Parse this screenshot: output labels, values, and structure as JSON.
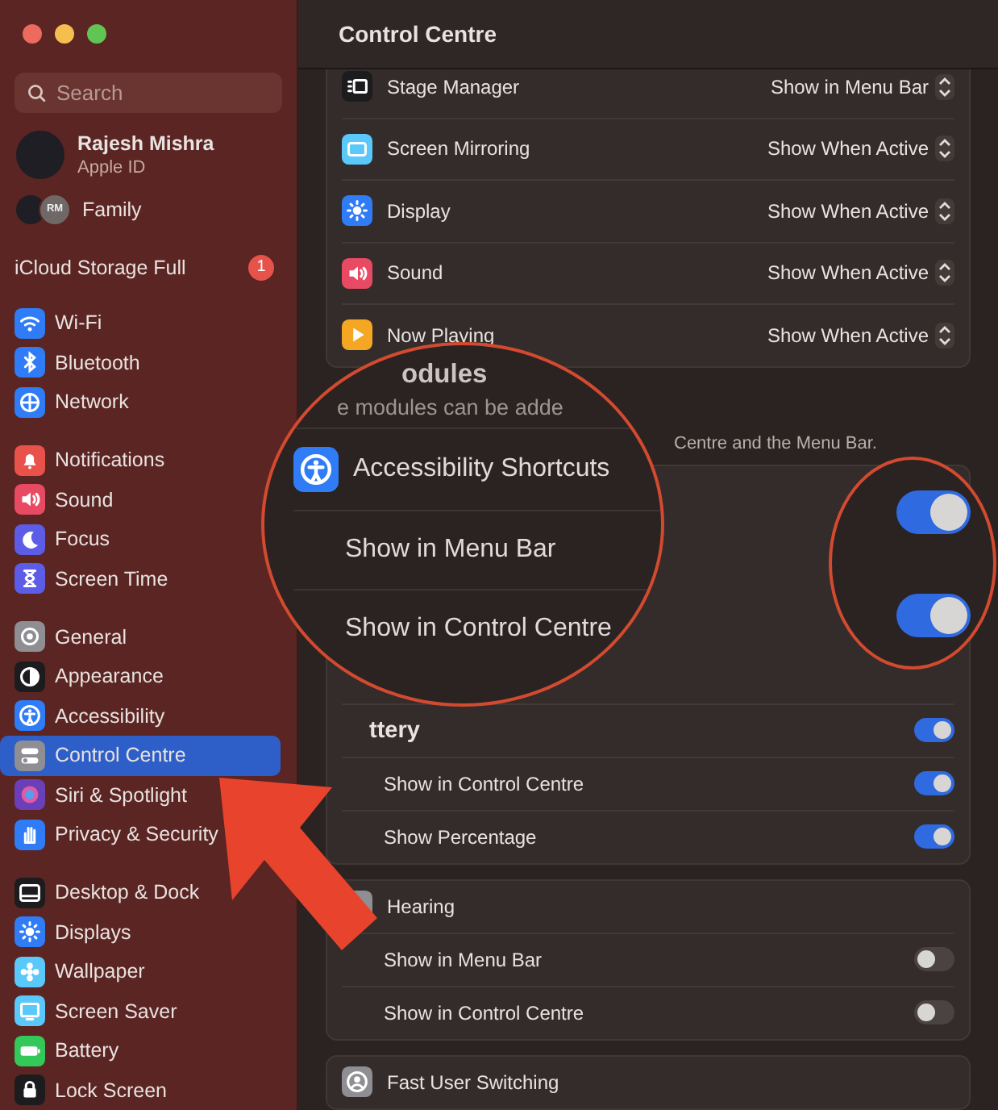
{
  "window": {
    "title": "Control Centre"
  },
  "sidebar": {
    "search": {
      "placeholder": "Search"
    },
    "account": {
      "name": "Rajesh Mishra",
      "subtitle": "Apple ID"
    },
    "family": {
      "initials": "RM",
      "label": "Family"
    },
    "alert": {
      "label": "iCloud Storage Full",
      "badge": "1"
    },
    "groups": [
      [
        {
          "label": "Wi-Fi",
          "selected": false
        },
        {
          "label": "Bluetooth",
          "selected": false
        },
        {
          "label": "Network",
          "selected": false
        }
      ],
      [
        {
          "label": "Notifications",
          "selected": false
        },
        {
          "label": "Sound",
          "selected": false
        },
        {
          "label": "Focus",
          "selected": false
        },
        {
          "label": "Screen Time",
          "selected": false
        }
      ],
      [
        {
          "label": "General",
          "selected": false
        },
        {
          "label": "Appearance",
          "selected": false
        },
        {
          "label": "Accessibility",
          "selected": false
        },
        {
          "label": "Control Centre",
          "selected": true
        },
        {
          "label": "Siri & Spotlight",
          "selected": false
        },
        {
          "label": "Privacy & Security",
          "selected": false
        }
      ],
      [
        {
          "label": "Desktop & Dock",
          "selected": false
        },
        {
          "label": "Displays",
          "selected": false
        },
        {
          "label": "Wallpaper",
          "selected": false
        },
        {
          "label": "Screen Saver",
          "selected": false
        },
        {
          "label": "Battery",
          "selected": false
        },
        {
          "label": "Lock Screen",
          "selected": false
        }
      ]
    ]
  },
  "modules": [
    {
      "label": "Stage Manager",
      "value": "Show in Menu Bar"
    },
    {
      "label": "Screen Mirroring",
      "value": "Show When Active"
    },
    {
      "label": "Display",
      "value": "Show When Active"
    },
    {
      "label": "Sound",
      "value": "Show When Active"
    },
    {
      "label": "Now Playing",
      "value": "Show When Active"
    }
  ],
  "other_modules_tail": "Centre and the Menu Bar.",
  "battery_card": {
    "label": "ttery",
    "on": true,
    "rows": [
      {
        "label": "Show in Control Centre",
        "on": true
      },
      {
        "label": "Show Percentage",
        "on": true
      }
    ]
  },
  "hearing_card": {
    "label": "Hearing",
    "rows": [
      {
        "label": "Show in Menu Bar",
        "on": false
      },
      {
        "label": "Show in Control Centre",
        "on": false
      }
    ]
  },
  "user_card": {
    "label": "Fast User Switching"
  },
  "magnifier": {
    "heading": "odules",
    "subtitle": "e modules can be adde",
    "module": "Accessibility Shortcuts",
    "rows": [
      {
        "label": "Show in Menu Bar",
        "on": true
      },
      {
        "label": "Show in Control Centre",
        "on": true
      }
    ]
  }
}
